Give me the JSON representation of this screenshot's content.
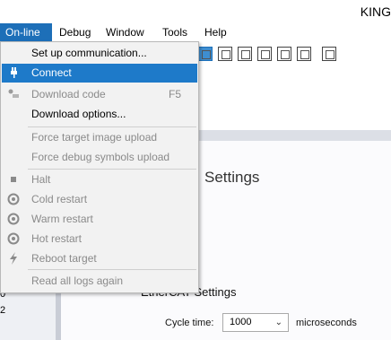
{
  "window": {
    "title": "KING"
  },
  "menubar": {
    "items": [
      {
        "label": "On-line",
        "active": true
      },
      {
        "label": "Debug"
      },
      {
        "label": "Window"
      },
      {
        "label": "Tools"
      },
      {
        "label": "Help"
      }
    ]
  },
  "dropdown": {
    "items": [
      {
        "label": "Set up communication...",
        "state": "normal"
      },
      {
        "label": "Connect",
        "state": "selected",
        "icon": "plug-icon"
      },
      {
        "label": "Download code",
        "shortcut": "F5",
        "state": "disabled",
        "icon": "download-icon"
      },
      {
        "label": "Download options...",
        "state": "normal"
      },
      {
        "label": "Force target image upload",
        "state": "disabled"
      },
      {
        "label": "Force debug symbols upload",
        "state": "disabled"
      },
      {
        "label": "Halt",
        "state": "disabled",
        "icon": "stop-icon"
      },
      {
        "label": "Cold restart",
        "state": "disabled",
        "icon": "restart-icon"
      },
      {
        "label": "Warm restart",
        "state": "disabled",
        "icon": "restart-icon"
      },
      {
        "label": "Hot restart",
        "state": "disabled",
        "icon": "restart-icon"
      },
      {
        "label": "Reboot target",
        "state": "disabled",
        "icon": "lightning-icon"
      },
      {
        "label": "Read all logs again",
        "state": "disabled"
      }
    ]
  },
  "left_panel": {
    "numbers": [
      "0",
      "2"
    ]
  },
  "main": {
    "settings_title": "Settings",
    "ethercat_title": "EtherCAT Settings",
    "cycle_time": {
      "label": "Cycle time:",
      "value": "1000",
      "unit": "microseconds"
    }
  },
  "colors": {
    "accent": "#1e7ac9",
    "menu_active": "#1d6fb8",
    "disabled_text": "#8a8a8a"
  }
}
